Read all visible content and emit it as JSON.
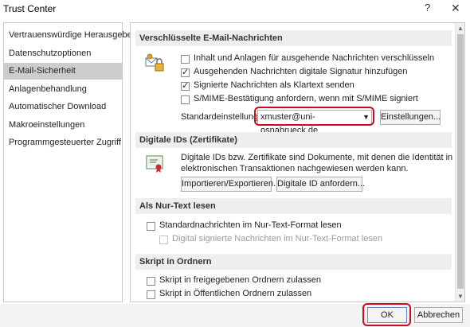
{
  "window": {
    "title": "Trust Center",
    "help_glyph": "?",
    "close_glyph": "✕"
  },
  "sidebar": {
    "items": [
      {
        "label": "Vertrauenswürdige Herausgeber"
      },
      {
        "label": "Datenschutzoptionen"
      },
      {
        "label": "E-Mail-Sicherheit",
        "selected": true
      },
      {
        "label": "Anlagenbehandlung"
      },
      {
        "label": "Automatischer Download"
      },
      {
        "label": "Makroeinstellungen"
      },
      {
        "label": "Programmgesteuerter Zugriff"
      }
    ]
  },
  "encrypted": {
    "header": "Verschlüsselte E-Mail-Nachrichten",
    "options": [
      {
        "label": "Inhalt und Anlagen für ausgehende Nachrichten verschlüsseln",
        "checked": false
      },
      {
        "label": "Ausgehenden Nachrichten digitale Signatur hinzufügen",
        "checked": true
      },
      {
        "label": "Signierte Nachrichten als Klartext senden",
        "checked": true
      },
      {
        "label": "S/MIME-Bestätigung anfordern, wenn mit S/MIME signiert",
        "checked": false
      }
    ],
    "default_setting_label": "Standardeinstellung:",
    "default_setting_value": "xmuster@uni-osnabrueck.de",
    "settings_button": "Einstellungen..."
  },
  "digital_ids": {
    "header": "Digitale IDs (Zertifikate)",
    "description_line1": "Digitale IDs bzw. Zertifikate sind Dokumente, mit denen die Identität in",
    "description_line2": "elektronischen Transaktionen nachgewiesen werden kann.",
    "import_export_button": "Importieren/Exportieren...",
    "request_button": "Digitale ID anfordern..."
  },
  "plain_text": {
    "header": "Als Nur-Text lesen",
    "option1": {
      "label": "Standardnachrichten im Nur-Text-Format lesen",
      "checked": false
    },
    "option2": {
      "label": "Digital signierte Nachrichten im Nur-Text-Format lesen",
      "checked": false,
      "enabled": false
    }
  },
  "folder_script": {
    "header": "Skript in Ordnern",
    "option1": {
      "label": "Skript in freigegebenen Ordnern zulassen",
      "checked": false
    },
    "option2": {
      "label": "Skript in Öffentlichen Ordnern zulassen",
      "checked": false
    }
  },
  "footer": {
    "ok_label": "OK",
    "cancel_label": "Abbrechen"
  },
  "colors": {
    "highlight_red": "#d10a1b",
    "selected_item": "#cdcdcd",
    "section_header_bg": "#eeeeee"
  }
}
